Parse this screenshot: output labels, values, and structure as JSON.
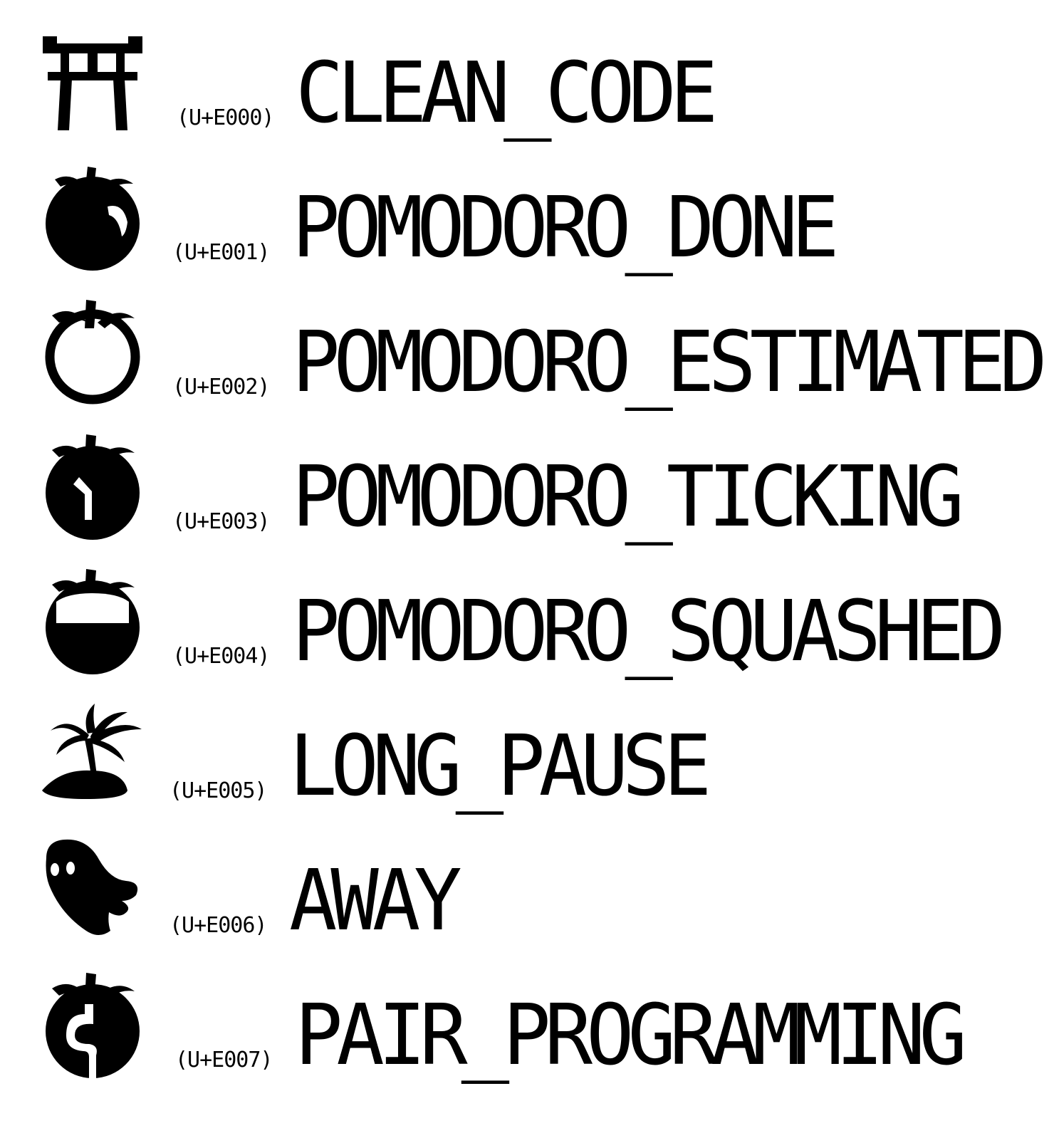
{
  "glyphs": [
    {
      "icon": "torii-gate-icon",
      "codepoint": "(U+E000)",
      "name": "CLEAN_CODE"
    },
    {
      "icon": "tomato-done-icon",
      "codepoint": "(U+E001)",
      "name": "POMODORO_DONE"
    },
    {
      "icon": "tomato-outline-icon",
      "codepoint": "(U+E002)",
      "name": "POMODORO_ESTIMATED"
    },
    {
      "icon": "tomato-clock-icon",
      "codepoint": "(U+E003)",
      "name": "POMODORO_TICKING"
    },
    {
      "icon": "tomato-squashed-icon",
      "codepoint": "(U+E004)",
      "name": "POMODORO_SQUASHED"
    },
    {
      "icon": "palm-island-icon",
      "codepoint": "(U+E005)",
      "name": "LONG_PAUSE"
    },
    {
      "icon": "ghost-icon",
      "codepoint": "(U+E006)",
      "name": "AWAY"
    },
    {
      "icon": "tomato-pair-icon",
      "codepoint": "(U+E007)",
      "name": "PAIR_PROGRAMMING"
    }
  ],
  "colors": {
    "foreground": "#000000",
    "background": "#ffffff"
  }
}
